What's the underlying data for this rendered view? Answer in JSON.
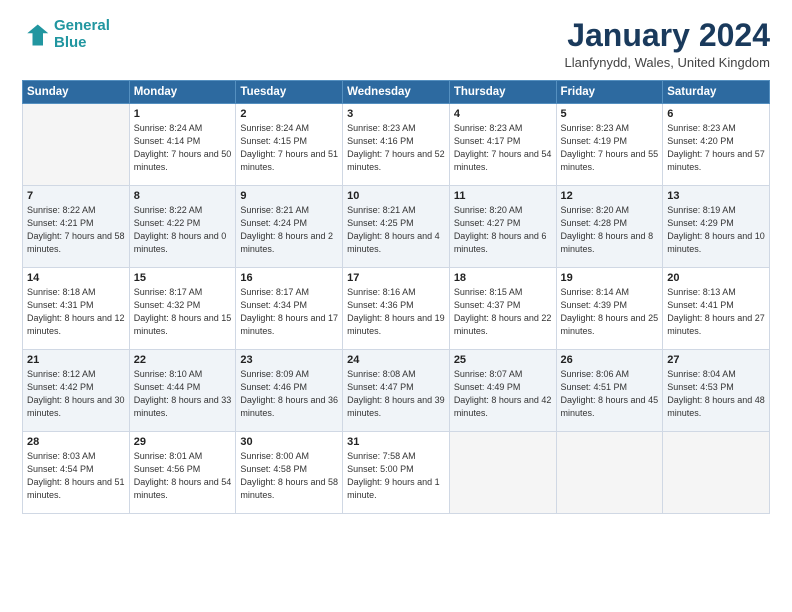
{
  "header": {
    "logo_line1": "General",
    "logo_line2": "Blue",
    "month_title": "January 2024",
    "location": "Llanfynydd, Wales, United Kingdom"
  },
  "days_of_week": [
    "Sunday",
    "Monday",
    "Tuesday",
    "Wednesday",
    "Thursday",
    "Friday",
    "Saturday"
  ],
  "weeks": [
    [
      {
        "day": "",
        "sunrise": "",
        "sunset": "",
        "daylight": ""
      },
      {
        "day": "1",
        "sunrise": "Sunrise: 8:24 AM",
        "sunset": "Sunset: 4:14 PM",
        "daylight": "Daylight: 7 hours and 50 minutes."
      },
      {
        "day": "2",
        "sunrise": "Sunrise: 8:24 AM",
        "sunset": "Sunset: 4:15 PM",
        "daylight": "Daylight: 7 hours and 51 minutes."
      },
      {
        "day": "3",
        "sunrise": "Sunrise: 8:23 AM",
        "sunset": "Sunset: 4:16 PM",
        "daylight": "Daylight: 7 hours and 52 minutes."
      },
      {
        "day": "4",
        "sunrise": "Sunrise: 8:23 AM",
        "sunset": "Sunset: 4:17 PM",
        "daylight": "Daylight: 7 hours and 54 minutes."
      },
      {
        "day": "5",
        "sunrise": "Sunrise: 8:23 AM",
        "sunset": "Sunset: 4:19 PM",
        "daylight": "Daylight: 7 hours and 55 minutes."
      },
      {
        "day": "6",
        "sunrise": "Sunrise: 8:23 AM",
        "sunset": "Sunset: 4:20 PM",
        "daylight": "Daylight: 7 hours and 57 minutes."
      }
    ],
    [
      {
        "day": "7",
        "sunrise": "Sunrise: 8:22 AM",
        "sunset": "Sunset: 4:21 PM",
        "daylight": "Daylight: 7 hours and 58 minutes."
      },
      {
        "day": "8",
        "sunrise": "Sunrise: 8:22 AM",
        "sunset": "Sunset: 4:22 PM",
        "daylight": "Daylight: 8 hours and 0 minutes."
      },
      {
        "day": "9",
        "sunrise": "Sunrise: 8:21 AM",
        "sunset": "Sunset: 4:24 PM",
        "daylight": "Daylight: 8 hours and 2 minutes."
      },
      {
        "day": "10",
        "sunrise": "Sunrise: 8:21 AM",
        "sunset": "Sunset: 4:25 PM",
        "daylight": "Daylight: 8 hours and 4 minutes."
      },
      {
        "day": "11",
        "sunrise": "Sunrise: 8:20 AM",
        "sunset": "Sunset: 4:27 PM",
        "daylight": "Daylight: 8 hours and 6 minutes."
      },
      {
        "day": "12",
        "sunrise": "Sunrise: 8:20 AM",
        "sunset": "Sunset: 4:28 PM",
        "daylight": "Daylight: 8 hours and 8 minutes."
      },
      {
        "day": "13",
        "sunrise": "Sunrise: 8:19 AM",
        "sunset": "Sunset: 4:29 PM",
        "daylight": "Daylight: 8 hours and 10 minutes."
      }
    ],
    [
      {
        "day": "14",
        "sunrise": "Sunrise: 8:18 AM",
        "sunset": "Sunset: 4:31 PM",
        "daylight": "Daylight: 8 hours and 12 minutes."
      },
      {
        "day": "15",
        "sunrise": "Sunrise: 8:17 AM",
        "sunset": "Sunset: 4:32 PM",
        "daylight": "Daylight: 8 hours and 15 minutes."
      },
      {
        "day": "16",
        "sunrise": "Sunrise: 8:17 AM",
        "sunset": "Sunset: 4:34 PM",
        "daylight": "Daylight: 8 hours and 17 minutes."
      },
      {
        "day": "17",
        "sunrise": "Sunrise: 8:16 AM",
        "sunset": "Sunset: 4:36 PM",
        "daylight": "Daylight: 8 hours and 19 minutes."
      },
      {
        "day": "18",
        "sunrise": "Sunrise: 8:15 AM",
        "sunset": "Sunset: 4:37 PM",
        "daylight": "Daylight: 8 hours and 22 minutes."
      },
      {
        "day": "19",
        "sunrise": "Sunrise: 8:14 AM",
        "sunset": "Sunset: 4:39 PM",
        "daylight": "Daylight: 8 hours and 25 minutes."
      },
      {
        "day": "20",
        "sunrise": "Sunrise: 8:13 AM",
        "sunset": "Sunset: 4:41 PM",
        "daylight": "Daylight: 8 hours and 27 minutes."
      }
    ],
    [
      {
        "day": "21",
        "sunrise": "Sunrise: 8:12 AM",
        "sunset": "Sunset: 4:42 PM",
        "daylight": "Daylight: 8 hours and 30 minutes."
      },
      {
        "day": "22",
        "sunrise": "Sunrise: 8:10 AM",
        "sunset": "Sunset: 4:44 PM",
        "daylight": "Daylight: 8 hours and 33 minutes."
      },
      {
        "day": "23",
        "sunrise": "Sunrise: 8:09 AM",
        "sunset": "Sunset: 4:46 PM",
        "daylight": "Daylight: 8 hours and 36 minutes."
      },
      {
        "day": "24",
        "sunrise": "Sunrise: 8:08 AM",
        "sunset": "Sunset: 4:47 PM",
        "daylight": "Daylight: 8 hours and 39 minutes."
      },
      {
        "day": "25",
        "sunrise": "Sunrise: 8:07 AM",
        "sunset": "Sunset: 4:49 PM",
        "daylight": "Daylight: 8 hours and 42 minutes."
      },
      {
        "day": "26",
        "sunrise": "Sunrise: 8:06 AM",
        "sunset": "Sunset: 4:51 PM",
        "daylight": "Daylight: 8 hours and 45 minutes."
      },
      {
        "day": "27",
        "sunrise": "Sunrise: 8:04 AM",
        "sunset": "Sunset: 4:53 PM",
        "daylight": "Daylight: 8 hours and 48 minutes."
      }
    ],
    [
      {
        "day": "28",
        "sunrise": "Sunrise: 8:03 AM",
        "sunset": "Sunset: 4:54 PM",
        "daylight": "Daylight: 8 hours and 51 minutes."
      },
      {
        "day": "29",
        "sunrise": "Sunrise: 8:01 AM",
        "sunset": "Sunset: 4:56 PM",
        "daylight": "Daylight: 8 hours and 54 minutes."
      },
      {
        "day": "30",
        "sunrise": "Sunrise: 8:00 AM",
        "sunset": "Sunset: 4:58 PM",
        "daylight": "Daylight: 8 hours and 58 minutes."
      },
      {
        "day": "31",
        "sunrise": "Sunrise: 7:58 AM",
        "sunset": "Sunset: 5:00 PM",
        "daylight": "Daylight: 9 hours and 1 minute."
      },
      {
        "day": "",
        "sunrise": "",
        "sunset": "",
        "daylight": ""
      },
      {
        "day": "",
        "sunrise": "",
        "sunset": "",
        "daylight": ""
      },
      {
        "day": "",
        "sunrise": "",
        "sunset": "",
        "daylight": ""
      }
    ]
  ]
}
